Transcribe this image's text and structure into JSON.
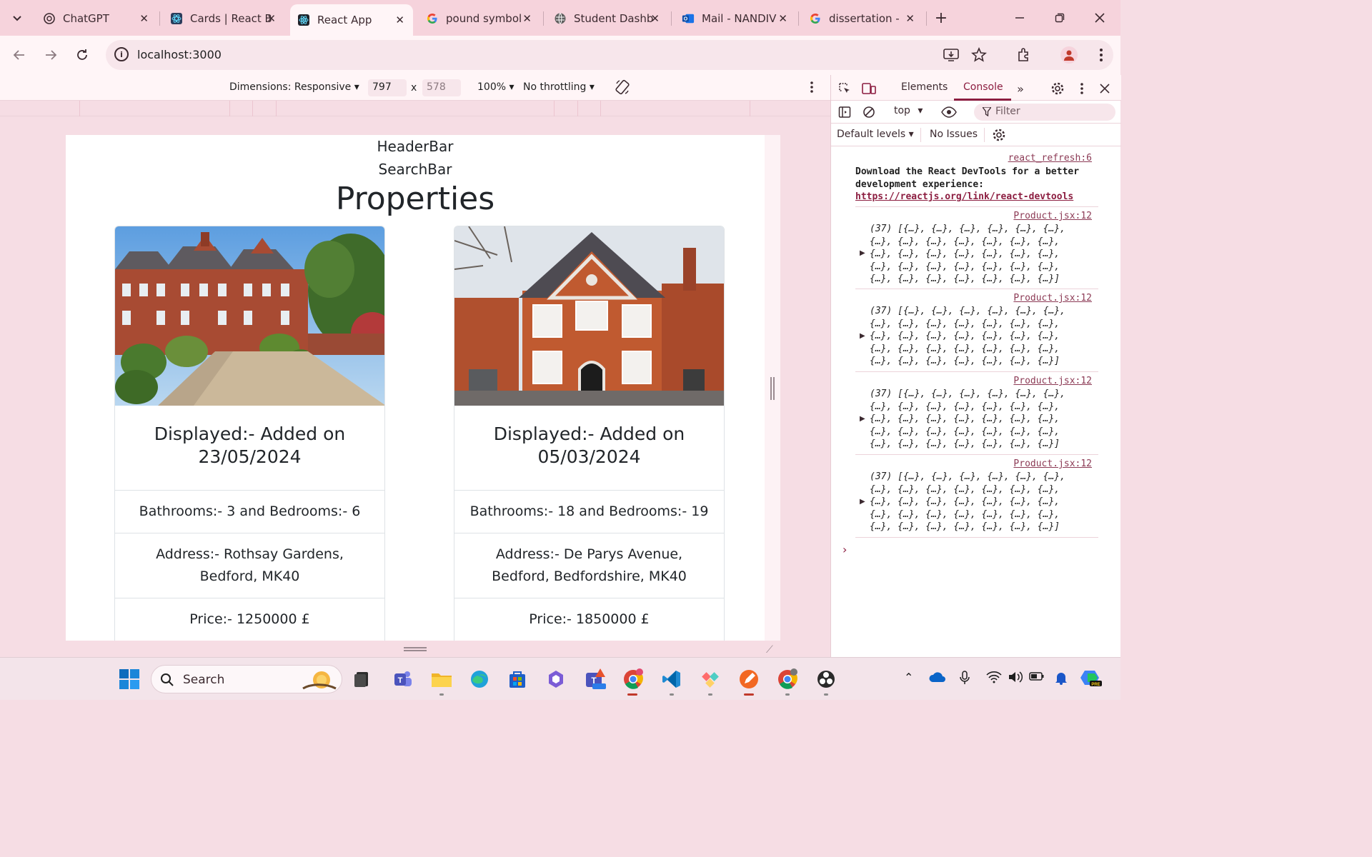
{
  "browser": {
    "tabs": [
      {
        "title": "ChatGPT",
        "icon": "chatgpt-icon"
      },
      {
        "title": "Cards | React B",
        "icon": "react-bootstrap-icon"
      },
      {
        "title": "React App",
        "icon": "react-icon",
        "active": true
      },
      {
        "title": "pound symbol",
        "icon": "google-icon"
      },
      {
        "title": "Student Dashb",
        "icon": "globe-icon"
      },
      {
        "title": "Mail - NANDIV",
        "icon": "outlook-icon"
      },
      {
        "title": "dissertation -",
        "icon": "google-icon"
      }
    ],
    "url": "localhost:3000"
  },
  "device_toolbar": {
    "dimensions_label": "Dimensions: Responsive",
    "width": "797",
    "times": "x",
    "height": "578",
    "zoom": "100%",
    "throttling": "No throttling"
  },
  "page": {
    "header": "HeaderBar",
    "search": "SearchBar",
    "heading": "Properties",
    "cards": [
      {
        "title": "Displayed:- Added on 23/05/2024",
        "rooms": "Bathrooms:- 3 and Bedrooms:- 6",
        "address": "Address:- Rothsay Gardens, Bedford, MK40",
        "price": "Price:- 1250000 £"
      },
      {
        "title": "Displayed:- Added on 05/03/2024",
        "rooms": "Bathrooms:- 18 and Bedrooms:- 19",
        "address": "Address:- De Parys Avenue, Bedford, Bedfordshire, MK40",
        "price": "Price:- 1850000 £"
      }
    ]
  },
  "devtools": {
    "tabs": [
      "Elements",
      "Console"
    ],
    "active_tab": "Console",
    "context": "top",
    "filter_placeholder": "Filter",
    "levels": "Default levels",
    "issues": "No Issues",
    "messages": [
      {
        "source": "react_refresh:6",
        "text": "Download the React DevTools for a better development experience:",
        "link": "https://reactjs.org/link/react-devtools"
      },
      {
        "source": "Product.jsx:12",
        "text": "(37) [{…}, {…}, {…}, {…}, {…}, {…},\n{…}, {…}, {…}, {…}, {…}, {…}, {…},\n{…}, {…}, {…}, {…}, {…}, {…}, {…},\n{…}, {…}, {…}, {…}, {…}, {…}, {…},\n{…}, {…}, {…}, {…}, {…}, {…}, {…}]"
      },
      {
        "source": "Product.jsx:12",
        "text": "(37) [{…}, {…}, {…}, {…}, {…}, {…},\n{…}, {…}, {…}, {…}, {…}, {…}, {…},\n{…}, {…}, {…}, {…}, {…}, {…}, {…},\n{…}, {…}, {…}, {…}, {…}, {…}, {…},\n{…}, {…}, {…}, {…}, {…}, {…}, {…}]"
      },
      {
        "source": "Product.jsx:12",
        "text": "(37) [{…}, {…}, {…}, {…}, {…}, {…},\n{…}, {…}, {…}, {…}, {…}, {…}, {…},\n{…}, {…}, {…}, {…}, {…}, {…}, {…},\n{…}, {…}, {…}, {…}, {…}, {…}, {…},\n{…}, {…}, {…}, {…}, {…}, {…}, {…}]"
      },
      {
        "source": "Product.jsx:12",
        "text": "(37) [{…}, {…}, {…}, {…}, {…}, {…},\n{…}, {…}, {…}, {…}, {…}, {…}, {…},\n{…}, {…}, {…}, {…}, {…}, {…}, {…},\n{…}, {…}, {…}, {…}, {…}, {…}, {…},\n{…}, {…}, {…}, {…}, {…}, {…}, {…}]"
      }
    ]
  },
  "taskbar": {
    "search_label": "Search",
    "apps": [
      "file-explorer-icon",
      "teams-icon",
      "folder-icon",
      "edge-icon",
      "store-icon",
      "copilot-icon",
      "teams-new-icon",
      "chrome-icon",
      "vscode-icon",
      "figma-like-icon",
      "pen-app-icon",
      "chrome-profile-icon",
      "obs-icon"
    ]
  },
  "colors": {
    "accent": "#8c1d40",
    "tabstrip": "#f6d3dc",
    "link": "#8c3a55"
  }
}
